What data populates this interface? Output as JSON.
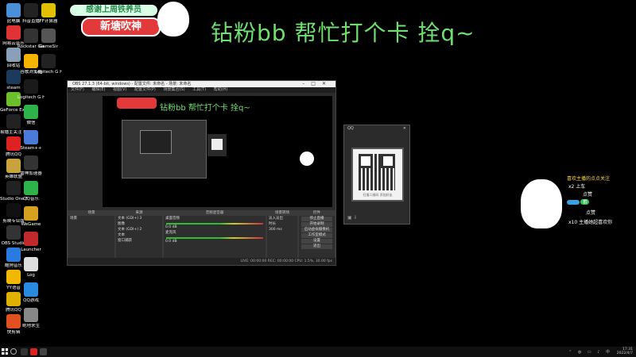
{
  "desktop": {
    "icons_col1": [
      {
        "label": "此电脑",
        "color": "#4a8fd8"
      },
      {
        "label": "网易云音乐",
        "color": "#e03333"
      },
      {
        "label": "回收站",
        "color": "#8aa0b8"
      },
      {
        "label": "steam",
        "color": "#1b3a5c"
      },
      {
        "label": "GeForce Experience",
        "color": "#6cbf2a"
      },
      {
        "label": "易播主关注 Rise",
        "color": "#222"
      },
      {
        "label": "腾讯QQ",
        "color": "#d22"
      },
      {
        "label": "英雄联盟",
        "color": "#c8a23a"
      },
      {
        "label": "Studio One 5",
        "color": "#222"
      },
      {
        "label": "剪映专业版",
        "color": "#111"
      },
      {
        "label": "OBS Studio",
        "color": "#333"
      },
      {
        "label": "酷狗音乐",
        "color": "#2a7be0"
      },
      {
        "label": "YY语音",
        "color": "#f2b700"
      },
      {
        "label": "腾讯QQ",
        "color": "#e0b000"
      },
      {
        "label": "快剪辑",
        "color": "#e05020"
      }
    ],
    "icons_col2": [
      {
        "label": "抖音直播",
        "color": "#222"
      },
      {
        "label": "Rockstar Games",
        "color": "#333"
      },
      {
        "label": "谷歌浏览器",
        "color": "#f4b400"
      },
      {
        "label": "Logitech G HUB",
        "color": "#1a1a1a"
      },
      {
        "label": "微信",
        "color": "#2db34a"
      },
      {
        "label": "Steam++",
        "color": "#4a7bd8"
      },
      {
        "label": "雷神加速器",
        "color": "#333"
      },
      {
        "label": "QQ音乐",
        "color": "#2db34a"
      },
      {
        "label": "WeGame",
        "color": "#d8a020"
      },
      {
        "label": "Launcher",
        "color": "#c02a2a"
      },
      {
        "label": "Log",
        "color": "#ddd"
      },
      {
        "label": "QQ游戏",
        "color": "#2a8ae0"
      },
      {
        "label": "绝地求生",
        "color": "#888"
      }
    ],
    "icons_col3": [
      {
        "label": "FF计算器",
        "color": "#e0c000"
      },
      {
        "label": "GameSir",
        "color": "#555"
      },
      {
        "label": "Logitech G HUB",
        "color": "#222"
      }
    ]
  },
  "banner": {
    "top_text": "感谢上周铁养员",
    "bottom_text": "新塘吹神"
  },
  "headline": "钻粉bb 帮忙打个卡 拴q~",
  "obs": {
    "title": "OBS 27.1.3 (64-bit, windows) - 配置文件: 未命名 - 场景: 未命名",
    "menu": [
      "文件(F)",
      "编辑(E)",
      "视图(V)",
      "配置文件(P)",
      "场景集合(S)",
      "工具(T)",
      "帮助(H)"
    ],
    "inner_title": "钻粉bb 帮忙打个卡 拴q~",
    "panels": {
      "scenes": {
        "header": "场景",
        "items": [
          "场景"
        ]
      },
      "sources": {
        "header": "来源",
        "items": [
          "文本 (GDI+) 3",
          "图像",
          "文本 (GDI+) 2",
          "文本",
          "窗口捕获"
        ]
      },
      "mixer": {
        "header": "音频混音器",
        "channels": [
          {
            "name": "桌面音频",
            "db": "0.0 dB"
          },
          {
            "name": "麦克风",
            "db": "0.0 dB"
          }
        ]
      },
      "transitions": {
        "header": "场景转场",
        "value": "淡入淡出",
        "duration_label": "时长",
        "duration": "300 ms"
      },
      "controls": {
        "header": "控件",
        "buttons": [
          "停止直播",
          "开始录制",
          "启动虚拟摄像机",
          "工作室模式",
          "设置",
          "退出"
        ]
      }
    },
    "status": "LIVE: 00:00:00  REC: 00:00:00  CPU: 1.5%, 30.00 fps"
  },
  "qr_window": {
    "title": "QQ",
    "caption": "扫描二维码 添加好友"
  },
  "overlay": {
    "heading": "喜欢主播的点点关注",
    "rows": [
      {
        "prefix": "x2",
        "text": "上车"
      },
      {
        "prefix": "",
        "text": "点赞"
      },
      {
        "prefix": "",
        "text": "群"
      },
      {
        "prefix": "",
        "text": "点赞"
      },
      {
        "prefix": "x10",
        "text": "主播她超喜欢你"
      }
    ]
  },
  "taskbar": {
    "time": "17:31",
    "date": "2022/4/7"
  }
}
